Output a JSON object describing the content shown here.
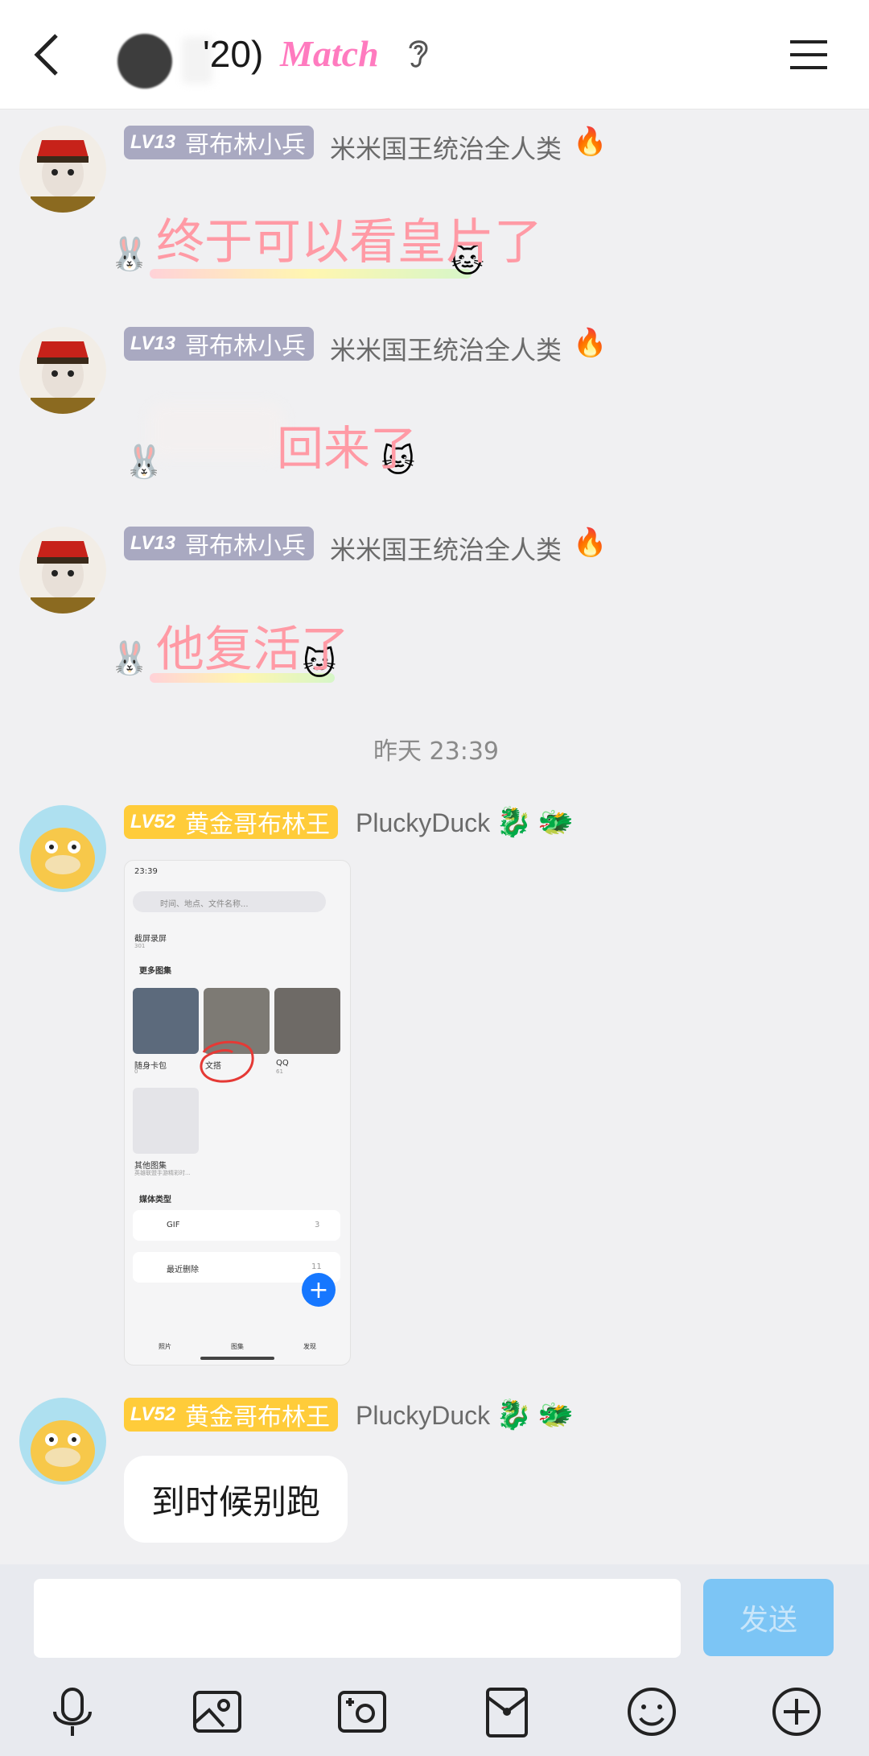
{
  "header": {
    "title": "'20)",
    "match_label": "Match"
  },
  "messages": [
    {
      "level": "LV13",
      "title_badge": "哥布林小兵",
      "username": "米米国王统治全人类",
      "sticker_text": "终于可以看皇片了"
    },
    {
      "level": "LV13",
      "title_badge": "哥布林小兵",
      "username": "米米国王统治全人类",
      "sticker_text": "回来了"
    },
    {
      "level": "LV13",
      "title_badge": "哥布林小兵",
      "username": "米米国王统治全人类",
      "sticker_text": "他复活了"
    },
    {
      "level": "LV52",
      "title_badge": "黄金哥布林王",
      "username": "PluckyDuck"
    },
    {
      "level": "LV52",
      "title_badge": "黄金哥布林王",
      "username": "PluckyDuck",
      "text": "到时候别跑"
    }
  ],
  "timestamp": "昨天 23:39",
  "shared_image": {
    "status_time": "23:39",
    "search_placeholder": "时间、地点、文件名称...",
    "top_album": "截屏录屏",
    "top_album_count": "301",
    "more_albums": "更多图集",
    "albums": [
      {
        "name": "随身卡包",
        "count": "0"
      },
      {
        "name": "文搭",
        "count": ""
      },
      {
        "name": "QQ",
        "count": "61"
      }
    ],
    "other_albums": "其他图集",
    "other_albums_sub": "英雄联盟手游精彩时...",
    "media_types": "媒体类型",
    "gif_label": "GIF",
    "gif_count": "3",
    "deleted_label": "最近删除",
    "deleted_count": "11",
    "tabs": [
      "照片",
      "图集",
      "发现"
    ]
  },
  "input": {
    "placeholder": "",
    "send_label": "发送"
  },
  "colors": {
    "accent": "#7cc5f5",
    "badge_gray": "#a9a9c1",
    "badge_gold": "#ffcc3a",
    "sticker_pink": "#ff9aa5"
  }
}
